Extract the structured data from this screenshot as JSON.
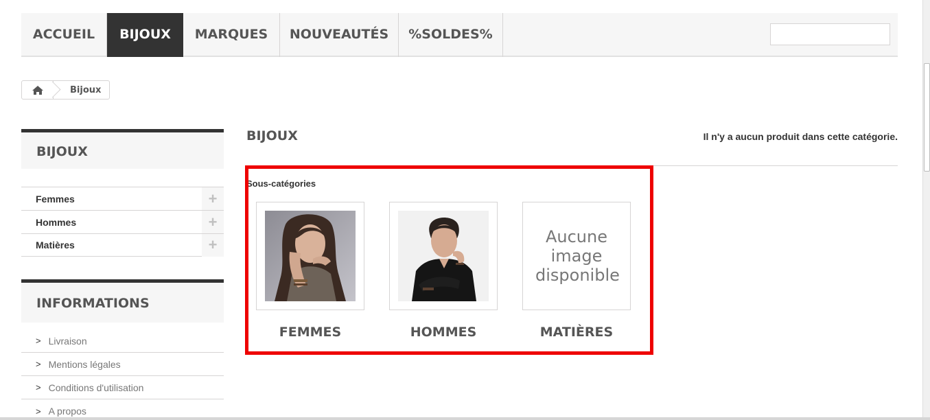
{
  "nav": {
    "items": [
      {
        "label": "ACCUEIL",
        "active": false
      },
      {
        "label": "BIJOUX",
        "active": true
      },
      {
        "label": "MARQUES",
        "active": false
      },
      {
        "label": "NOUVEAUTÉS",
        "active": false
      },
      {
        "label": "%SOLDES%",
        "active": false
      }
    ],
    "search_value": ""
  },
  "breadcrumb": {
    "home_icon": "home-icon",
    "current": "Bijoux"
  },
  "sidebar": {
    "categories_title": "BIJOUX",
    "categories": [
      "Femmes",
      "Hommes",
      "Matières"
    ],
    "expand_icon": "plus-icon",
    "info_title": "INFORMATIONS",
    "info_links": [
      "Livraison",
      "Mentions légales",
      "Conditions d'utilisation",
      "A propos"
    ]
  },
  "main": {
    "title": "BIJOUX",
    "no_products": "Il n'y a aucun produit dans cette catégorie.",
    "subcategories_heading": "Sous-catégories",
    "subcategories": [
      {
        "name": "FEMMES",
        "image": "photo-woman"
      },
      {
        "name": "HOMMES",
        "image": "photo-man"
      },
      {
        "name": "MATIÈRES",
        "image_placeholder": "Aucune image disponible"
      }
    ]
  },
  "colors": {
    "nav_active_bg": "#333333",
    "highlight": "#ee0000",
    "panel_bg": "#f6f6f6",
    "border": "#d6d4d4"
  }
}
